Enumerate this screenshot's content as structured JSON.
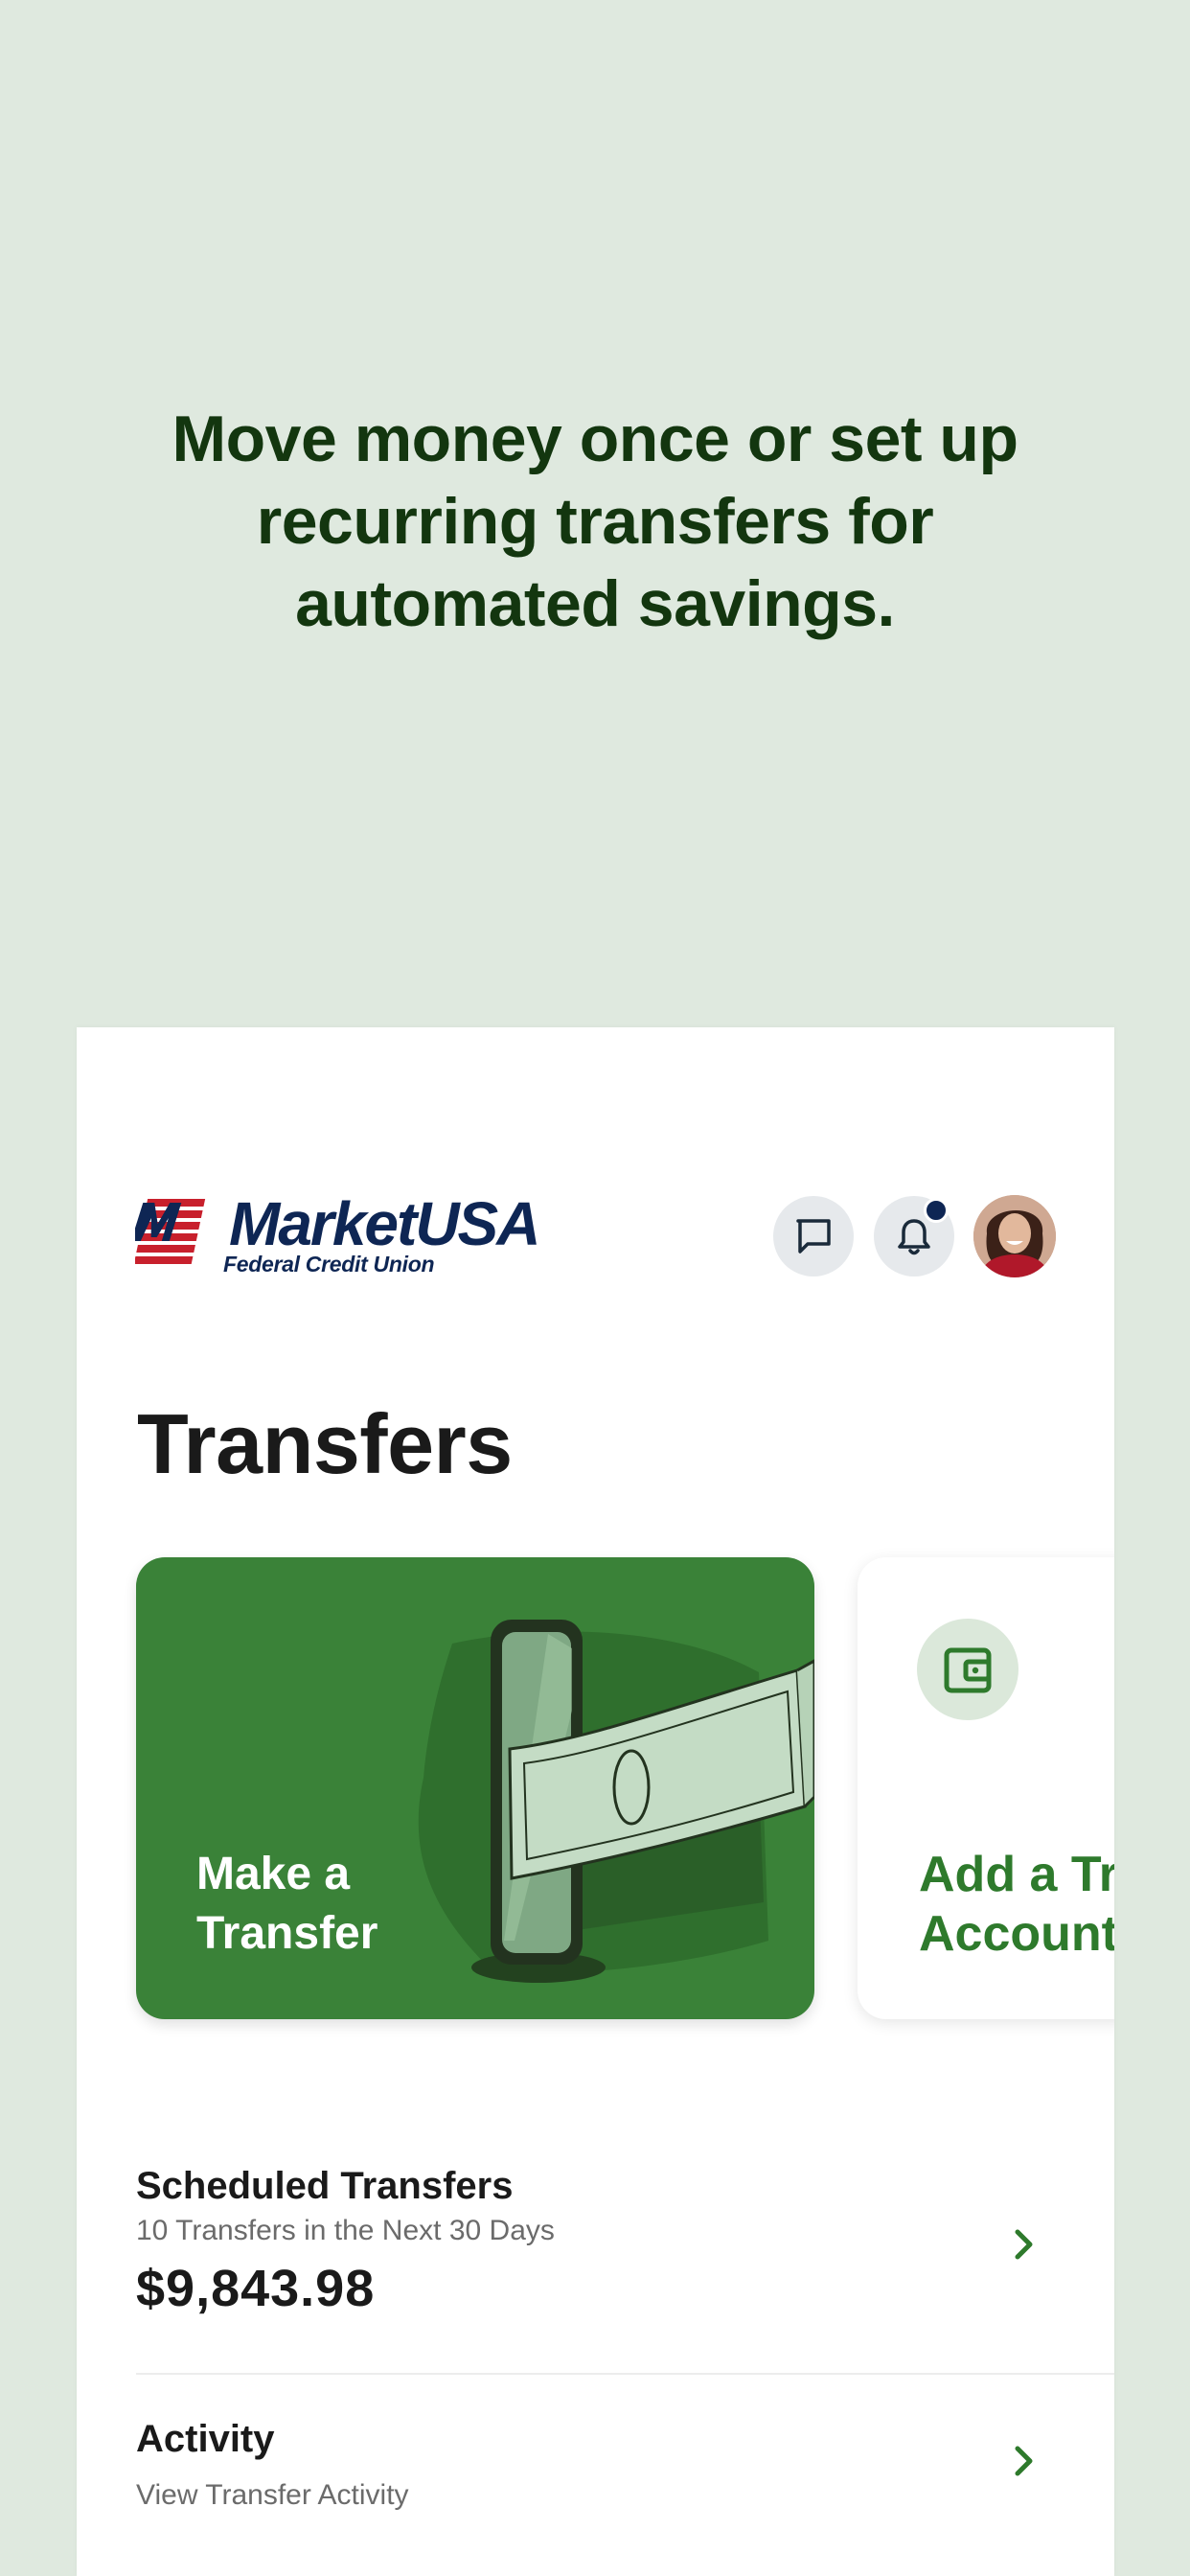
{
  "headline": "Move money once or set up recurring transfers for automated savings.",
  "header": {
    "logo_brand": "MarketUSA",
    "logo_sub": "Federal Credit Union",
    "has_notification": true
  },
  "page_title": "Transfers",
  "cards": {
    "make_transfer": "Make a\nTransfer",
    "add_account": "Add a Transfer\nAccount"
  },
  "scheduled": {
    "title": "Scheduled Transfers",
    "subtitle": "10 Transfers in the Next 30 Days",
    "amount": "$9,843.98"
  },
  "activity": {
    "title": "Activity",
    "subtitle": "View Transfer Activity"
  },
  "colors": {
    "background": "#dfe9df",
    "headline": "#13360f",
    "primary_green": "#3a8238",
    "brand_navy": "#0e2654"
  }
}
